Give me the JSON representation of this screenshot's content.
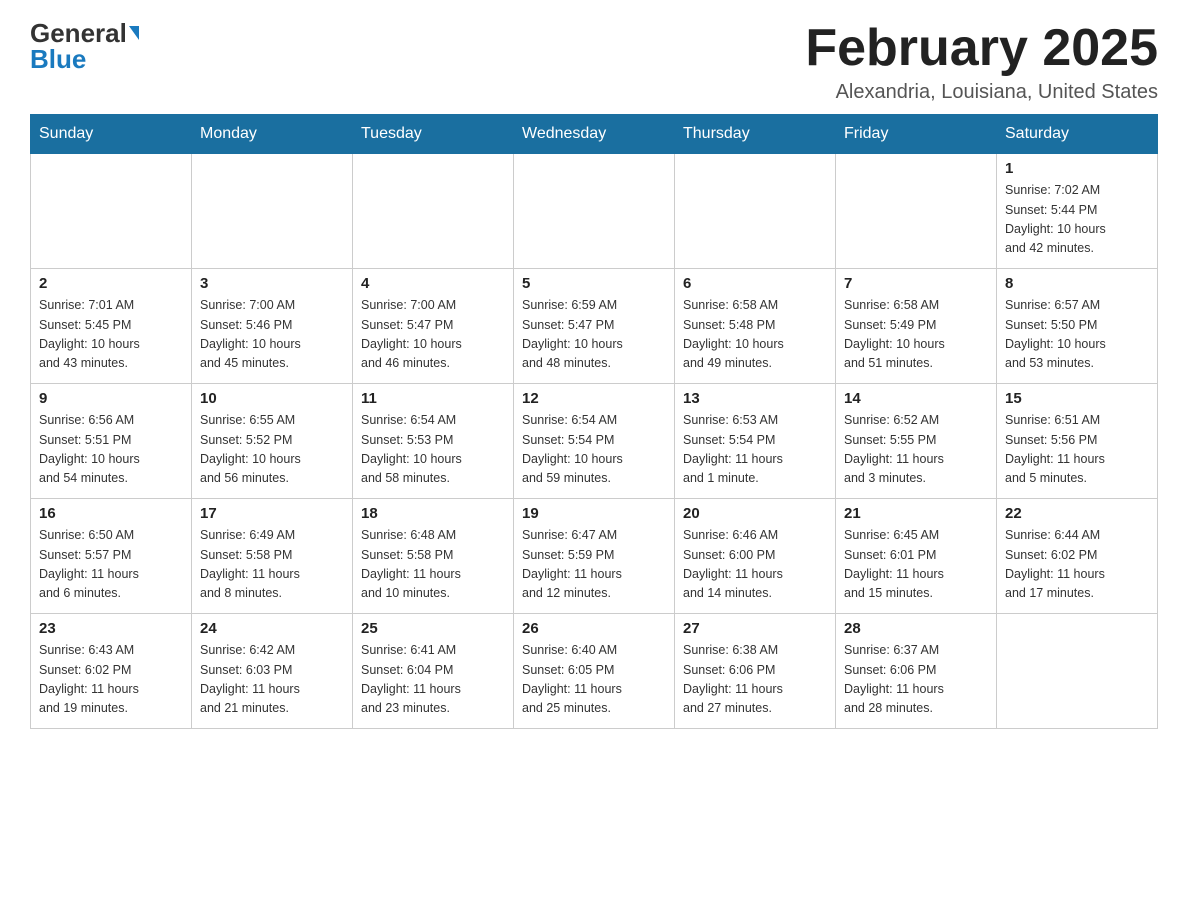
{
  "header": {
    "logo_general": "General",
    "logo_blue": "Blue",
    "month_title": "February 2025",
    "location": "Alexandria, Louisiana, United States"
  },
  "days_of_week": [
    "Sunday",
    "Monday",
    "Tuesday",
    "Wednesday",
    "Thursday",
    "Friday",
    "Saturday"
  ],
  "weeks": [
    [
      {
        "day": "",
        "info": ""
      },
      {
        "day": "",
        "info": ""
      },
      {
        "day": "",
        "info": ""
      },
      {
        "day": "",
        "info": ""
      },
      {
        "day": "",
        "info": ""
      },
      {
        "day": "",
        "info": ""
      },
      {
        "day": "1",
        "info": "Sunrise: 7:02 AM\nSunset: 5:44 PM\nDaylight: 10 hours\nand 42 minutes."
      }
    ],
    [
      {
        "day": "2",
        "info": "Sunrise: 7:01 AM\nSunset: 5:45 PM\nDaylight: 10 hours\nand 43 minutes."
      },
      {
        "day": "3",
        "info": "Sunrise: 7:00 AM\nSunset: 5:46 PM\nDaylight: 10 hours\nand 45 minutes."
      },
      {
        "day": "4",
        "info": "Sunrise: 7:00 AM\nSunset: 5:47 PM\nDaylight: 10 hours\nand 46 minutes."
      },
      {
        "day": "5",
        "info": "Sunrise: 6:59 AM\nSunset: 5:47 PM\nDaylight: 10 hours\nand 48 minutes."
      },
      {
        "day": "6",
        "info": "Sunrise: 6:58 AM\nSunset: 5:48 PM\nDaylight: 10 hours\nand 49 minutes."
      },
      {
        "day": "7",
        "info": "Sunrise: 6:58 AM\nSunset: 5:49 PM\nDaylight: 10 hours\nand 51 minutes."
      },
      {
        "day": "8",
        "info": "Sunrise: 6:57 AM\nSunset: 5:50 PM\nDaylight: 10 hours\nand 53 minutes."
      }
    ],
    [
      {
        "day": "9",
        "info": "Sunrise: 6:56 AM\nSunset: 5:51 PM\nDaylight: 10 hours\nand 54 minutes."
      },
      {
        "day": "10",
        "info": "Sunrise: 6:55 AM\nSunset: 5:52 PM\nDaylight: 10 hours\nand 56 minutes."
      },
      {
        "day": "11",
        "info": "Sunrise: 6:54 AM\nSunset: 5:53 PM\nDaylight: 10 hours\nand 58 minutes."
      },
      {
        "day": "12",
        "info": "Sunrise: 6:54 AM\nSunset: 5:54 PM\nDaylight: 10 hours\nand 59 minutes."
      },
      {
        "day": "13",
        "info": "Sunrise: 6:53 AM\nSunset: 5:54 PM\nDaylight: 11 hours\nand 1 minute."
      },
      {
        "day": "14",
        "info": "Sunrise: 6:52 AM\nSunset: 5:55 PM\nDaylight: 11 hours\nand 3 minutes."
      },
      {
        "day": "15",
        "info": "Sunrise: 6:51 AM\nSunset: 5:56 PM\nDaylight: 11 hours\nand 5 minutes."
      }
    ],
    [
      {
        "day": "16",
        "info": "Sunrise: 6:50 AM\nSunset: 5:57 PM\nDaylight: 11 hours\nand 6 minutes."
      },
      {
        "day": "17",
        "info": "Sunrise: 6:49 AM\nSunset: 5:58 PM\nDaylight: 11 hours\nand 8 minutes."
      },
      {
        "day": "18",
        "info": "Sunrise: 6:48 AM\nSunset: 5:58 PM\nDaylight: 11 hours\nand 10 minutes."
      },
      {
        "day": "19",
        "info": "Sunrise: 6:47 AM\nSunset: 5:59 PM\nDaylight: 11 hours\nand 12 minutes."
      },
      {
        "day": "20",
        "info": "Sunrise: 6:46 AM\nSunset: 6:00 PM\nDaylight: 11 hours\nand 14 minutes."
      },
      {
        "day": "21",
        "info": "Sunrise: 6:45 AM\nSunset: 6:01 PM\nDaylight: 11 hours\nand 15 minutes."
      },
      {
        "day": "22",
        "info": "Sunrise: 6:44 AM\nSunset: 6:02 PM\nDaylight: 11 hours\nand 17 minutes."
      }
    ],
    [
      {
        "day": "23",
        "info": "Sunrise: 6:43 AM\nSunset: 6:02 PM\nDaylight: 11 hours\nand 19 minutes."
      },
      {
        "day": "24",
        "info": "Sunrise: 6:42 AM\nSunset: 6:03 PM\nDaylight: 11 hours\nand 21 minutes."
      },
      {
        "day": "25",
        "info": "Sunrise: 6:41 AM\nSunset: 6:04 PM\nDaylight: 11 hours\nand 23 minutes."
      },
      {
        "day": "26",
        "info": "Sunrise: 6:40 AM\nSunset: 6:05 PM\nDaylight: 11 hours\nand 25 minutes."
      },
      {
        "day": "27",
        "info": "Sunrise: 6:38 AM\nSunset: 6:06 PM\nDaylight: 11 hours\nand 27 minutes."
      },
      {
        "day": "28",
        "info": "Sunrise: 6:37 AM\nSunset: 6:06 PM\nDaylight: 11 hours\nand 28 minutes."
      },
      {
        "day": "",
        "info": ""
      }
    ]
  ]
}
